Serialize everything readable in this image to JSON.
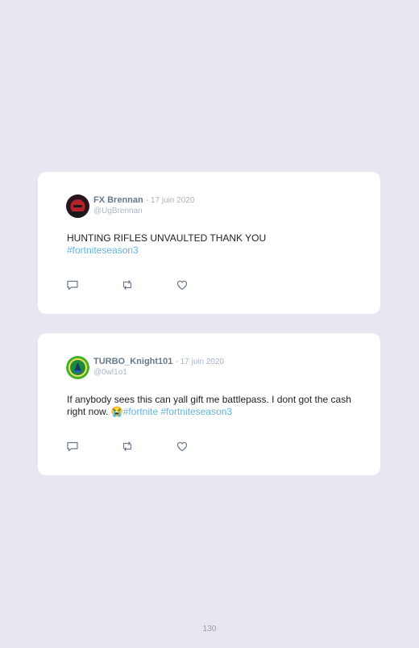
{
  "tweets": [
    {
      "name": "FX Brennan",
      "date": "- 17 juin 2020",
      "handle": "@UgBrennan",
      "text": "HUNTING RIFLES UNVAULTED THANK YOU",
      "hashtags": [
        "#fortniteseason3"
      ]
    },
    {
      "name": "TURBO_Knight101",
      "date": "- 17 juin 2020",
      "handle": "@0wl1o1",
      "text": "If anybody sees this can yall gift me battlepass. I dont got the cash right now. ",
      "emoji": "😭",
      "hashtags": [
        "#fortnite",
        "#fortniteseason3"
      ]
    }
  ],
  "icons": [
    "reply-icon",
    "retweet-icon",
    "like-icon"
  ],
  "colors": {
    "background": "#e9e6f2",
    "card": "#ffffff",
    "hashtag": "#63b4dc",
    "name": "#667a8c",
    "muted": "#a9b6c3"
  },
  "page_number": "130"
}
